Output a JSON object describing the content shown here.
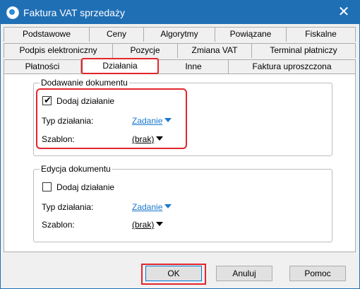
{
  "window": {
    "title": "Faktura VAT sprzedaży"
  },
  "tabs": {
    "row1": [
      "Podstawowe",
      "Ceny",
      "Algorytmy",
      "Powiązane",
      "Fiskalne"
    ],
    "row2": [
      "Podpis elektroniczny",
      "Pozycje",
      "Zmiana VAT",
      "Terminal płatniczy"
    ],
    "row3": [
      "Płatności",
      "Działania",
      "Inne",
      "Faktura uproszczona"
    ],
    "active": "Działania"
  },
  "adding": {
    "legend": "Dodawanie dokumentu",
    "checkbox_label": "Dodaj działanie",
    "checked": true,
    "type_label": "Typ działania:",
    "type_value": "Zadanie",
    "template_label": "Szablon:",
    "template_value": "(brak)"
  },
  "editing": {
    "legend": "Edycja dokumentu",
    "checkbox_label": "Dodaj działanie",
    "checked": false,
    "type_label": "Typ działania:",
    "type_value": "Zadanie",
    "template_label": "Szablon:",
    "template_value": "(brak)"
  },
  "buttons": {
    "ok": "OK",
    "cancel": "Anuluj",
    "help": "Pomoc"
  },
  "colors": {
    "titlebar": "#1f6fb5",
    "highlight": "#e3262b",
    "link": "#1a78cf"
  }
}
